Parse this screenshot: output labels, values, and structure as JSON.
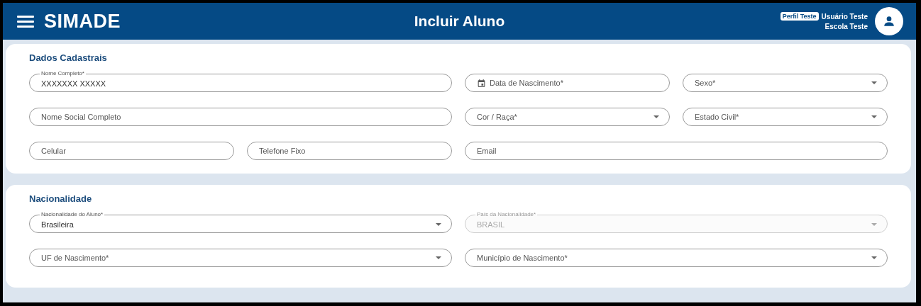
{
  "header": {
    "logo": "SIMADE",
    "title": "Incluir Aluno",
    "profile_badge": "Perfil Teste",
    "user_name": "Usuário Teste",
    "school": "Escola Teste"
  },
  "sections": [
    {
      "title": "Dados Cadastrais",
      "fields": [
        {
          "kind": "text",
          "label": "Nome Completo*",
          "value": "XXXXXXX XXXXX",
          "disabled": false
        },
        {
          "kind": "date",
          "placeholder": "Data de Nascimento*",
          "disabled": false
        },
        {
          "kind": "select",
          "placeholder": "Sexo*",
          "disabled": false
        },
        {
          "kind": "text",
          "placeholder": "Nome Social Completo",
          "disabled": false
        },
        {
          "kind": "select",
          "placeholder": "Cor / Raça*",
          "disabled": false
        },
        {
          "kind": "select",
          "placeholder": "Estado Civil*",
          "disabled": false
        },
        {
          "kind": "text",
          "placeholder": "Celular",
          "disabled": false
        },
        {
          "kind": "text",
          "placeholder": "Telefone Fixo",
          "disabled": false
        },
        {
          "kind": "text",
          "placeholder": "Email",
          "disabled": false
        }
      ]
    },
    {
      "title": "Nacionalidade",
      "fields": [
        {
          "kind": "select",
          "label": "Nacionalidade do Aluno*",
          "value": "Brasileira",
          "disabled": false
        },
        {
          "kind": "select",
          "label": "País da Nacionalidade*",
          "value": "BRASIL",
          "disabled": true
        },
        {
          "kind": "select",
          "placeholder": "UF de Nascimento*",
          "disabled": false
        },
        {
          "kind": "select",
          "placeholder": "Município de Nascimento*",
          "disabled": false
        }
      ]
    }
  ]
}
